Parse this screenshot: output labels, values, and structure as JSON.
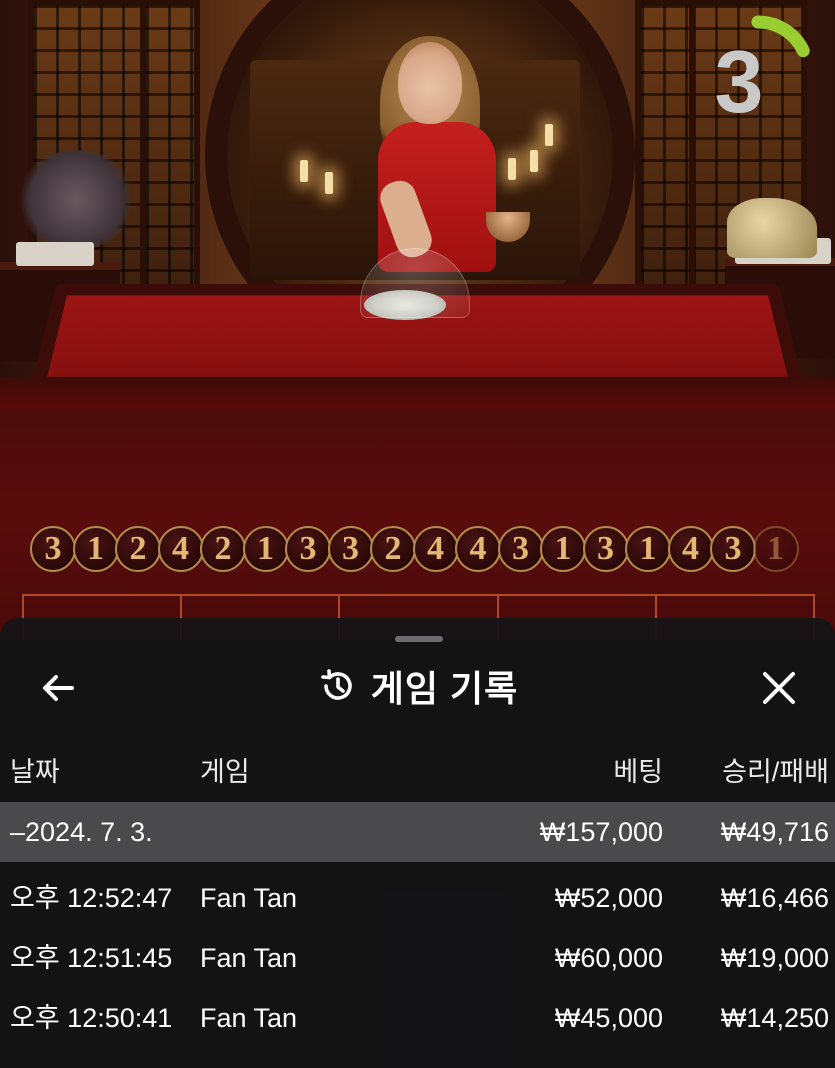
{
  "countdown": {
    "value": "3",
    "progress_fraction": 0.18,
    "color": "#9acd32"
  },
  "results": [
    "3",
    "1",
    "2",
    "4",
    "2",
    "1",
    "3",
    "3",
    "2",
    "4",
    "4",
    "3",
    "1",
    "3",
    "1",
    "4",
    "3",
    "1"
  ],
  "history": {
    "title": "게임 기록",
    "icons": {
      "back": "arrow-left-icon",
      "history": "history-clock-icon",
      "close": "close-icon"
    },
    "columns": {
      "date": "날짜",
      "game": "게임",
      "bet": "베팅",
      "win_loss": "승리/패배"
    },
    "summary": {
      "date": "–2024. 7. 3.",
      "bet": "₩157,000",
      "win_loss": "₩49,716"
    },
    "rows": [
      {
        "time": "오후 12:52:47",
        "game": "Fan Tan",
        "bet": "₩52,000",
        "win_loss": "₩16,466"
      },
      {
        "time": "오후 12:51:45",
        "game": "Fan Tan",
        "bet": "₩60,000",
        "win_loss": "₩19,000"
      },
      {
        "time": "오후 12:50:41",
        "game": "Fan Tan",
        "bet": "₩45,000",
        "win_loss": "₩14,250"
      }
    ]
  }
}
